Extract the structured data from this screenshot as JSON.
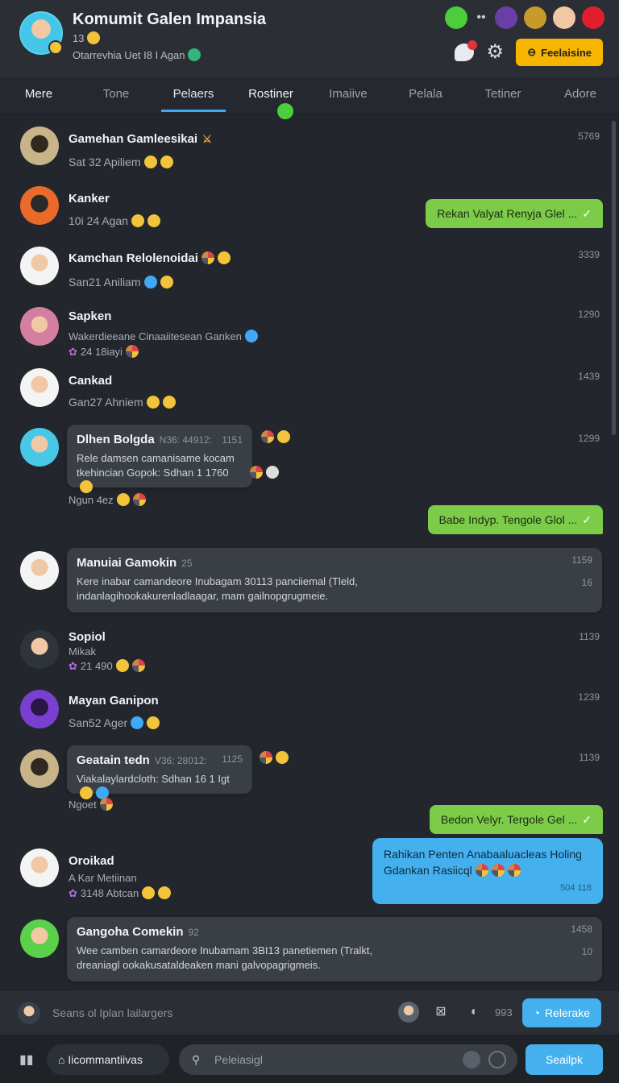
{
  "header": {
    "title": "Komumit Galen Impansia",
    "members": "13",
    "status": "Otarrevhia Uet I8 I Agan",
    "action_label": "Feelaisine"
  },
  "tabs": [
    "Mere",
    "Tone",
    "Pelaers",
    "Rostiner",
    "Imaiive",
    "Pelala",
    "Tetiner",
    "Adore"
  ],
  "messages": [
    {
      "name": "Gamehan Gamleesikai",
      "sub": "Sat 32 Apiliem",
      "time": "5769"
    },
    {
      "name": "Kanker",
      "sub": "10i 24 Agan"
    },
    {
      "name": "Kamchan Relolenoidai",
      "sub": "San21 Aniliam",
      "time": "3339"
    },
    {
      "name": "Sapken",
      "sub": "Wakerdieeane Cinaaiitesean Ganken",
      "sub2": "24 18iayi",
      "time": "1290"
    },
    {
      "name": "Cankad",
      "sub": "Gan27 Ahniem",
      "time": "1439"
    },
    {
      "name": "Sopiol",
      "sub": "Mikak",
      "sub2": "21 490",
      "time": "1139"
    },
    {
      "name": "Mayan Ganipon",
      "sub": "San52 Ager",
      "time": "1239"
    },
    {
      "name": "Oroikad",
      "sub": "A Kar Metiinan",
      "sub2": "3148 Abtcan"
    }
  ],
  "cards": [
    {
      "title": "Dlhen Bolgda",
      "meta": "N36: 44912:",
      "num": "1151",
      "line1": "Rele damsen camanisame kocam",
      "line2": "tkehincian Gopok: Sdhan 1 1760",
      "after": "Ngun 4ez",
      "time": "1299"
    },
    {
      "title": "Manuiai Gamokin",
      "meta": "25",
      "num": "1159",
      "num2": "16",
      "line1": "Kere inabar camandeore Inubagam 30113 panciiemal (Tleld,",
      "line2": "indanlagihookakurenladlaagar, mam gailnopgrugmeie."
    },
    {
      "title": "Geatain tedn",
      "meta": "V36: 28012:",
      "num": "1125",
      "line1": "Viakalaylardcloth: Sdhan 16 1 Igt",
      "after": "Ngoet",
      "time": "1139"
    },
    {
      "title": "Gangoha Comekin",
      "meta": "92",
      "num": "1458",
      "num2": "10",
      "line1": "Wee camben camardeore Inubamam 3BI13 panetiemen (Tralkt,",
      "line2": "dreaniagl ookakusataldeaken mani galvopagrigmeis."
    }
  ],
  "outgoing": [
    {
      "text": "Rekan Valyat Renyja Glel ..."
    },
    {
      "text": "Babe Indyp. Tengole Glol ..."
    },
    {
      "text": "Bedon Velyr. Tergole Gel ..."
    }
  ],
  "outgoing_blue": {
    "text": "Rahikan Penten Anabaaluacleas Holing Gdankan Rasiicql",
    "time": "504 118"
  },
  "composer": {
    "placeholder": "Seans ol Iplan lailargers",
    "count": "993",
    "button": "Relerake"
  },
  "bottom": {
    "chip": "Iicommantiivas",
    "search_placeholder": "Peleiasigl",
    "send": "Seailpk"
  },
  "colors": {
    "accent_blue": "#45b0ee",
    "accent_green": "#7ccc4a",
    "accent_yellow": "#f7b500"
  }
}
